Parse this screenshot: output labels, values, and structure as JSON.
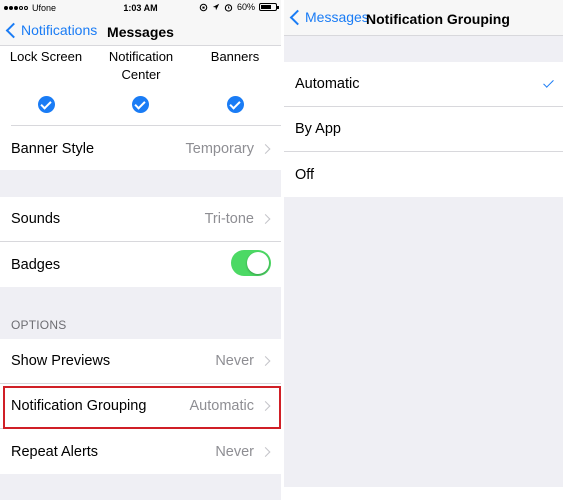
{
  "left": {
    "status_bar": {
      "carrier": "Ufone",
      "time": "1:03 AM",
      "battery": "60%"
    },
    "nav": {
      "back_label": "Notifications",
      "title": "Messages"
    },
    "alert_types": [
      {
        "label": "Lock Screen",
        "checked": true
      },
      {
        "label": "Notification Center",
        "checked": true
      },
      {
        "label": "Banners",
        "checked": true
      }
    ],
    "banner_style": {
      "label": "Banner Style",
      "value": "Temporary"
    },
    "sounds": {
      "label": "Sounds",
      "value": "Tri-tone"
    },
    "badges": {
      "label": "Badges",
      "on": true
    },
    "options_header": "OPTIONS",
    "show_previews": {
      "label": "Show Previews",
      "value": "Never"
    },
    "notification_grouping": {
      "label": "Notification Grouping",
      "value": "Automatic"
    },
    "repeat_alerts": {
      "label": "Repeat Alerts",
      "value": "Never"
    }
  },
  "right": {
    "nav": {
      "back_label": "Messages",
      "title": "Notification Grouping"
    },
    "options": [
      {
        "label": "Automatic",
        "selected": true
      },
      {
        "label": "By App",
        "selected": false
      },
      {
        "label": "Off",
        "selected": false
      }
    ]
  },
  "colors": {
    "accent": "#1a7cf5",
    "toggle_on": "#4cd964",
    "highlight": "#d01f26",
    "background": "#efeff4"
  }
}
